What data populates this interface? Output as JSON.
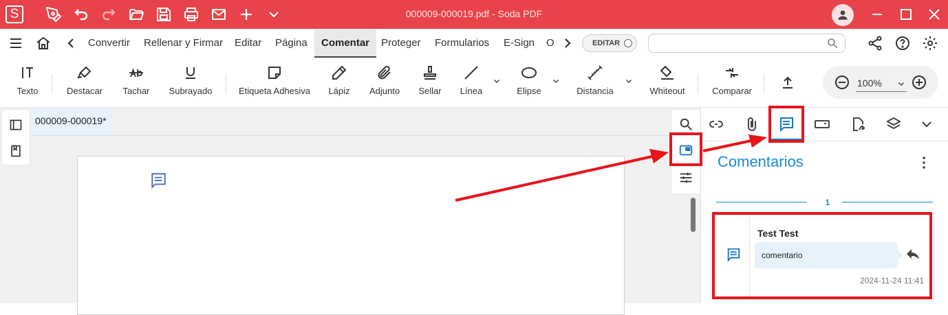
{
  "window": {
    "title": "000009-000019.pdf  -  Soda PDF",
    "logo_letter": "S",
    "accent": "#e8434a"
  },
  "menu": {
    "items": [
      "Convertir",
      "Rellenar y Firmar",
      "Editar",
      "Página",
      "Comentar",
      "Proteger",
      "Formularios",
      "E-Sign",
      "Ot"
    ],
    "active": "Comentar",
    "editar_toggle": "EDITAR",
    "search_placeholder": ""
  },
  "toolbar": {
    "tools": {
      "texto": "Texto",
      "destacar": "Destacar",
      "tachar": "Tachar",
      "subrayado": "Subrayado",
      "etiqueta": "Etiqueta Adhesiva",
      "lapiz": "Lápiz",
      "adjunto": "Adjunto",
      "sellar": "Sellar",
      "linea": "Línea",
      "elipse": "Elipse",
      "distancia": "Distancia",
      "whiteout": "Whiteout",
      "comparar": "Comparar"
    },
    "zoom": "100%"
  },
  "document": {
    "tab_name": "000009-000019*"
  },
  "panel": {
    "title": "Comentarios",
    "page_number": "1",
    "comment": {
      "author": "Test Test",
      "text": "comentario",
      "timestamp": "2024-11-24 11:41"
    }
  },
  "colors": {
    "panel_accent": "#1a8bd8",
    "annotation": "#e8141b"
  }
}
